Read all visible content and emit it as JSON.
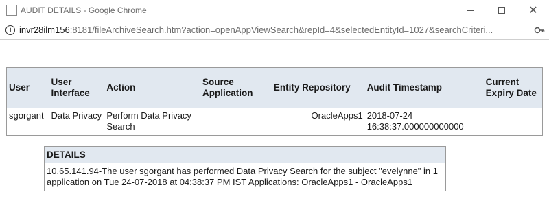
{
  "window": {
    "title": "AUDIT DETAILS - Google Chrome",
    "minimize_icon": "minimize-icon",
    "maximize_icon": "maximize-icon",
    "close_icon": "close-icon"
  },
  "address_bar": {
    "host": "invr28ilm156",
    "rest": ":8181/fileArchiveSearch.htm?action=openAppViewSearch&repId=4&selectedEntityId=1027&searchCriteri..."
  },
  "audit_table": {
    "headers": {
      "user": "User",
      "user_interface": "User Interface",
      "action": "Action",
      "source_application": "Source Application",
      "entity_repository": "Entity Repository",
      "audit_timestamp": "Audit Timestamp",
      "current_expiry_date": "Current Expiry Date"
    },
    "row": {
      "user": "sgorgant",
      "user_interface": "Data Privacy",
      "action": "Perform Data Privacy Search",
      "source_application": "",
      "entity_repository": "OracleApps1",
      "audit_timestamp": "2018-07-24 16:38:37.000000000000",
      "current_expiry_date": ""
    }
  },
  "details": {
    "heading": "DETAILS",
    "text": "10.65.141.94-The user sgorgant has performed Data Privacy Search for the subject \"evelynne\" in 1 application on Tue 24-07-2018 at 04:38:37 PM IST Applications: OracleApps1 - OracleApps1"
  }
}
